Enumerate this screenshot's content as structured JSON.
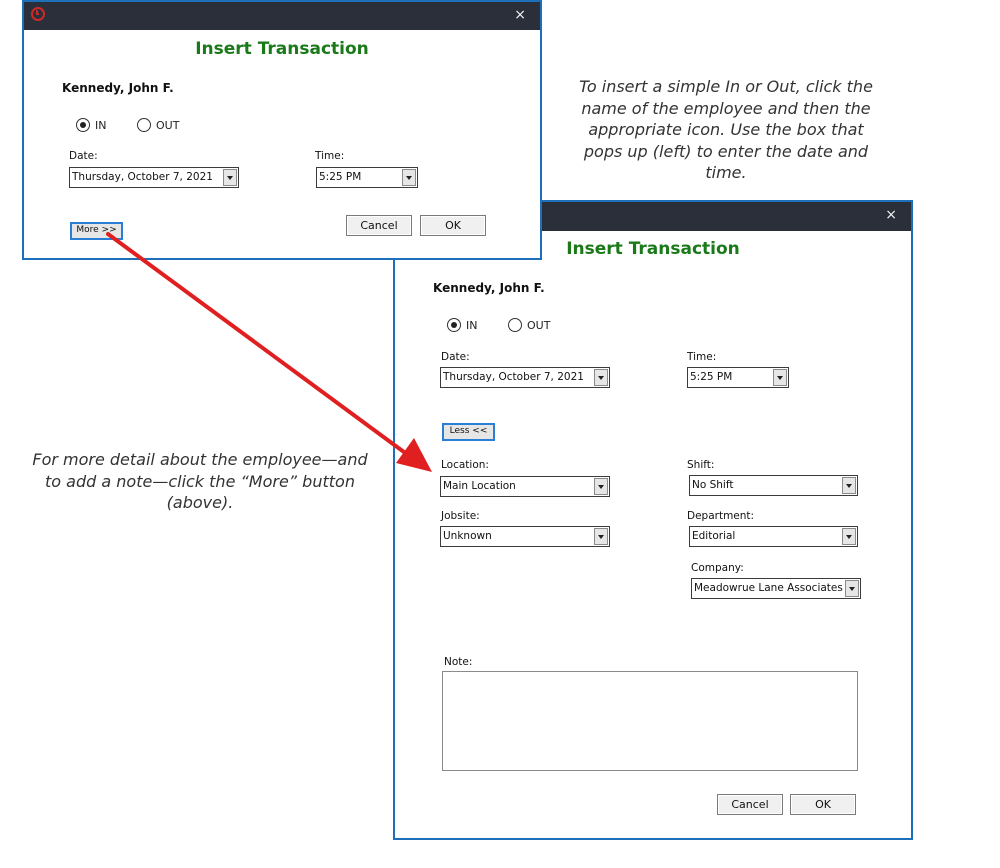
{
  "small_dialog": {
    "title": "Insert Transaction",
    "close_glyph": "×",
    "employee": "Kennedy, John F.",
    "radio_in": "IN",
    "radio_out": "OUT",
    "selected": "IN",
    "date_label": "Date:",
    "date_value": "Thursday, October  7, 2021",
    "time_label": "Time:",
    "time_value": "5:25  PM",
    "more_button": "More >>",
    "cancel_button": "Cancel",
    "ok_button": "OK"
  },
  "large_dialog": {
    "title": "Insert Transaction",
    "close_glyph": "×",
    "employee": "Kennedy, John F.",
    "radio_in": "IN",
    "radio_out": "OUT",
    "selected": "IN",
    "date_label": "Date:",
    "date_value": "Thursday, October  7, 2021",
    "time_label": "Time:",
    "time_value": "5:25  PM",
    "less_button": "Less <<",
    "location_label": "Location:",
    "location_value": "Main Location",
    "shift_label": "Shift:",
    "shift_value": "No Shift",
    "jobsite_label": "Jobsite:",
    "jobsite_value": "Unknown",
    "department_label": "Department:",
    "department_value": "Editorial",
    "company_label": "Company:",
    "company_value": "Meadowrue Lane Associates",
    "note_label": "Note:",
    "note_value": "",
    "cancel_button": "Cancel",
    "ok_button": "OK"
  },
  "annotations": {
    "top_right": "To insert a simple In or Out, click the name of the employee and then the appropriate icon. Use the box that pops up (left) to enter the date and time.",
    "left": "For more detail about the employee—and to add a note—click the “More” button (above)."
  },
  "colors": {
    "title_green": "#1a7a1a",
    "border_blue": "#1e6fba",
    "titlebar_dark": "#2b2f3a",
    "arrow_red": "#e02020"
  },
  "icons": {
    "app": "red-circle-clock-icon",
    "close": "close-icon",
    "combo": "chevron-down-icon"
  }
}
